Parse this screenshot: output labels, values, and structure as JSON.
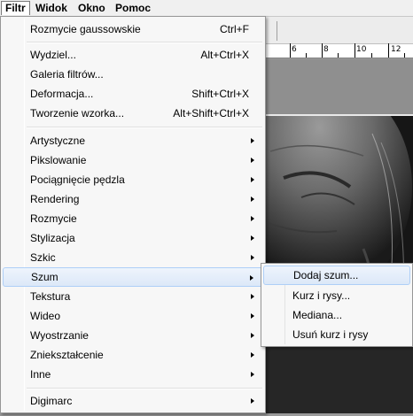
{
  "menubar": {
    "items": [
      {
        "label": "Filtr"
      },
      {
        "label": "Widok"
      },
      {
        "label": "Okno"
      },
      {
        "label": "Pomoc"
      }
    ]
  },
  "filter_menu": {
    "last_filter": {
      "label": "Rozmycie gaussowskie",
      "shortcut": "Ctrl+F"
    },
    "group_commands": [
      {
        "label": "Wydziel...",
        "shortcut": "Alt+Ctrl+X"
      },
      {
        "label": "Galeria filtrów...",
        "shortcut": ""
      },
      {
        "label": "Deformacja...",
        "shortcut": "Shift+Ctrl+X"
      },
      {
        "label": "Tworzenie wzorka...",
        "shortcut": "Alt+Shift+Ctrl+X"
      }
    ],
    "group_categories": [
      {
        "label": "Artystyczne"
      },
      {
        "label": "Pikslowanie"
      },
      {
        "label": "Pociągnięcie pędzla"
      },
      {
        "label": "Rendering"
      },
      {
        "label": "Rozmycie"
      },
      {
        "label": "Stylizacja"
      },
      {
        "label": "Szkic"
      },
      {
        "label": "Szum"
      },
      {
        "label": "Tekstura"
      },
      {
        "label": "Wideo"
      },
      {
        "label": "Wyostrzanie"
      },
      {
        "label": "Zniekształcenie"
      },
      {
        "label": "Inne"
      }
    ],
    "group_plugins": [
      {
        "label": "Digimarc"
      }
    ],
    "highlighted": "Szum"
  },
  "noise_submenu": {
    "items": [
      {
        "label": "Dodaj szum..."
      },
      {
        "label": "Kurz i rysy..."
      },
      {
        "label": "Mediana..."
      },
      {
        "label": "Usuń kurz i rysy"
      }
    ],
    "highlighted": "Dodaj szum..."
  },
  "ruler": {
    "labels": [
      "6",
      "8",
      "10",
      "12"
    ]
  }
}
